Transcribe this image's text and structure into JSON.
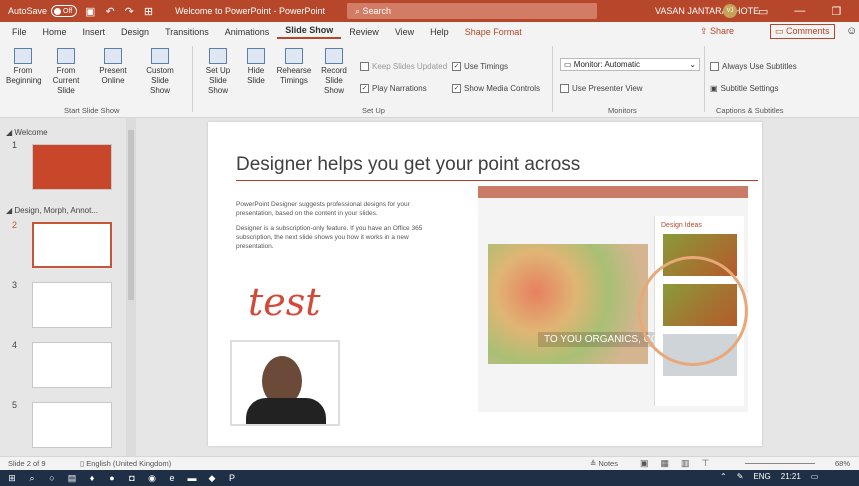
{
  "titlebar": {
    "autosave_label": "AutoSave",
    "autosave_state": "Off",
    "doc_title": "Welcome to PowerPoint - PowerPoint",
    "search_placeholder": "Search",
    "user_name": "VASAN JANTARACHOTE",
    "user_initials": "VJ"
  },
  "menu": {
    "tabs": [
      "File",
      "Home",
      "Insert",
      "Design",
      "Transitions",
      "Animations",
      "Slide Show",
      "Review",
      "View",
      "Help",
      "Shape Format"
    ],
    "share": "Share",
    "comments": "Comments"
  },
  "ribbon": {
    "start": {
      "from_beginning": "From Beginning",
      "from_current": "From Current Slide",
      "present_online": "Present Online",
      "custom": "Custom Slide Show",
      "label": "Start Slide Show"
    },
    "setup": {
      "setup_show": "Set Up Slide Show",
      "hide": "Hide Slide",
      "rehearse": "Rehearse Timings",
      "record": "Record Slide Show",
      "keep_updated": "Keep Slides Updated",
      "use_timings": "Use Timings",
      "play_narrations": "Play Narrations",
      "show_media": "Show Media Controls",
      "label": "Set Up"
    },
    "monitors": {
      "monitor_label": "Monitor:",
      "monitor_value": "Automatic",
      "presenter_view": "Use Presenter View",
      "label": "Monitors"
    },
    "captions": {
      "always_subtitles": "Always Use Subtitles",
      "subtitle_settings": "Subtitle Settings",
      "label": "Captions & Subtitles"
    }
  },
  "panel": {
    "section1": "Welcome",
    "section2": "Design, Morph, Annot...",
    "thumbs": [
      "1",
      "2",
      "3",
      "4",
      "5"
    ]
  },
  "slide": {
    "title": "Designer helps you get your point across",
    "para1": "PowerPoint Designer suggests professional designs for your presentation, based on the content in your slides.",
    "para2": "Designer is a subscription-only feature. If you have an Office 365 subscription, the next slide shows you how it works in a new presentation.",
    "ink_text": "test",
    "design_ideas": "Design Ideas",
    "org": "TO YOU ORGANICS, CO."
  },
  "status": {
    "slide": "Slide 2 of 9",
    "lang": "English (United Kingdom)",
    "notes": "Notes",
    "zoom": "68%"
  },
  "taskbar": {
    "lang": "ENG",
    "time": "21:21"
  }
}
